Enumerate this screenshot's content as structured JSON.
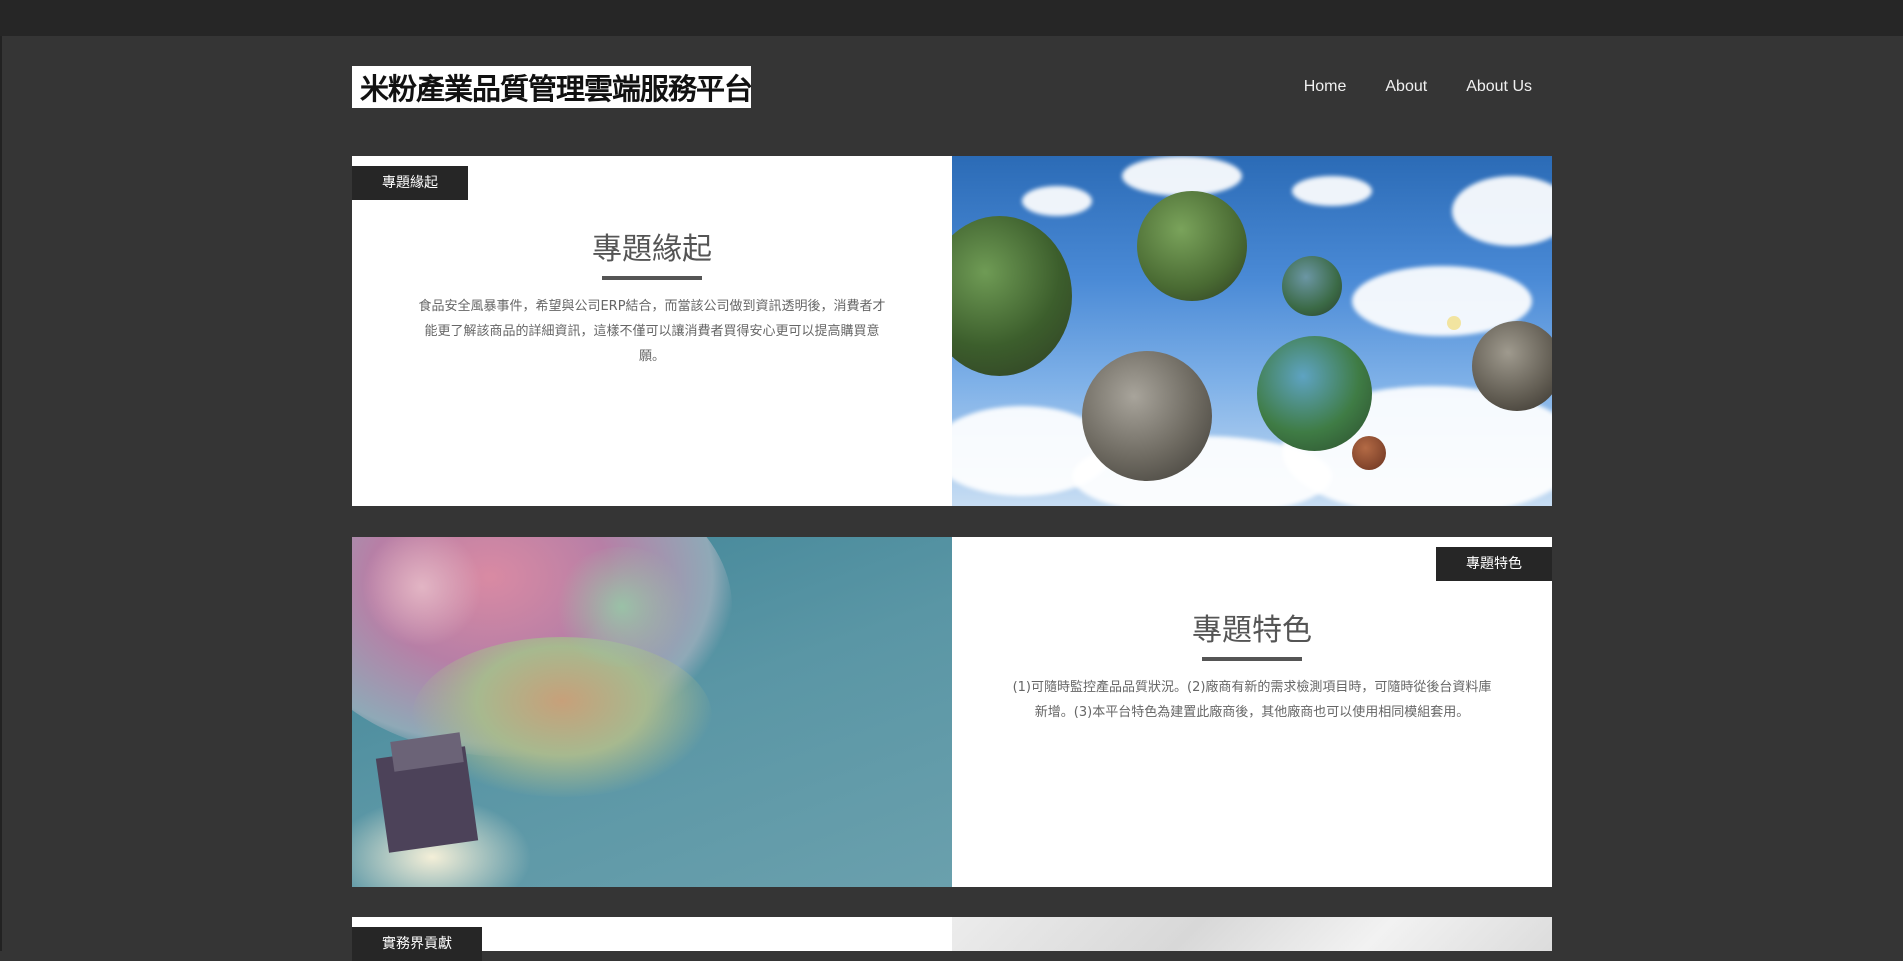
{
  "header": {
    "logo_text": "米粉產業品質管理雲端服務平台",
    "nav": [
      "Home",
      "About",
      "About Us"
    ]
  },
  "sections": [
    {
      "tag": "專題緣起",
      "title": "專題緣起",
      "body": "食品安全風暴事件，希望與公司ERP結合，而當該公司做到資訊透明後，消費者才能更了解該商品的詳細資訊，這樣不僅可以讓消費者買得安心更可以提高購買意願。"
    },
    {
      "tag": "專題特色",
      "title": "專題特色",
      "body": "(1)可隨時監控產品品質狀況。(2)廠商有新的需求檢測項目時，可隨時從後台資料庫新增。(3)本平台特色為建置此廠商後，其他廠商也可以使用相同模組套用。"
    },
    {
      "tag": "實務界貢獻"
    }
  ],
  "colors": {
    "page_background": "#353535",
    "top_bar": "#262626",
    "tag_background": "#262626",
    "panel_background": "#ffffff"
  },
  "icons": []
}
